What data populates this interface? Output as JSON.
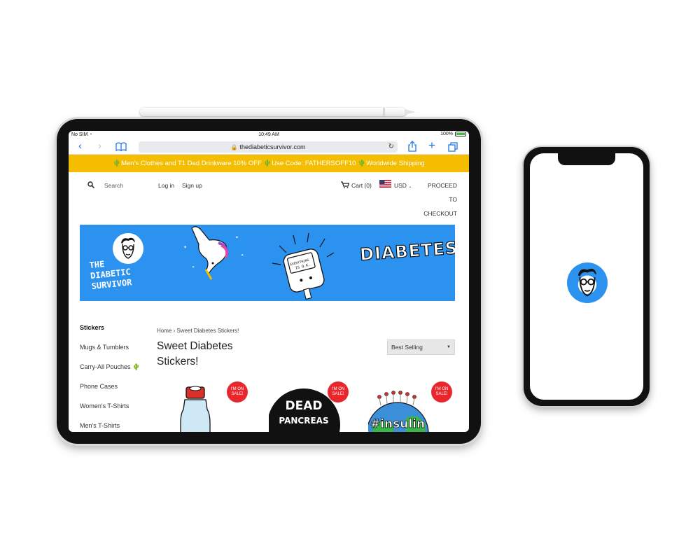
{
  "status_bar": {
    "carrier": "No SIM",
    "time": "10:49 AM",
    "battery": "100%"
  },
  "browser": {
    "url": "thediabeticsurvivor.com"
  },
  "promo": {
    "text": "🌵Men's Clothes and T1 Dad Drinkware 10% OFF 🌵Use Code: FATHERSOFF10 🌵Worldwide Shipping"
  },
  "header": {
    "search_label": "Search",
    "login": "Log in",
    "signup": "Sign up",
    "cart": "Cart (0)",
    "currency": "USD",
    "proceed_line1": "PROCEED TO",
    "proceed_line2": "CHECKOUT"
  },
  "banner": {
    "brand_line1": "THE",
    "brand_line2": "DIABETIC",
    "brand_line3": "SURVIVOR",
    "meter_text_1": "EVERYTHING",
    "meter_text_2": "IS O.K.",
    "headline": "DIABETES"
  },
  "sidebar": {
    "items": [
      {
        "label": "Stickers"
      },
      {
        "label": "Mugs & Tumblers"
      },
      {
        "label": "Carry-All Pouches 🌵"
      },
      {
        "label": "Phone Cases"
      },
      {
        "label": "Women's T-Shirts"
      },
      {
        "label": "Men's T-Shirts"
      }
    ]
  },
  "main": {
    "breadcrumb": "Home › Sweet Diabetes Stickers!",
    "title": "Sweet Diabetes Stickers!",
    "sort_value": "Best Selling"
  },
  "products": {
    "sale_badge_line1": "I'M ON",
    "sale_badge_line2": "SALE!",
    "p2_line1": "DEAD",
    "p2_line2": "PANCREAS",
    "p3_text": "#insulin"
  },
  "colors": {
    "accent_blue": "#2b92ef",
    "promo_yellow": "#f5bd00",
    "sale_red": "#e8262c",
    "ios_blue": "#1d77e6"
  }
}
